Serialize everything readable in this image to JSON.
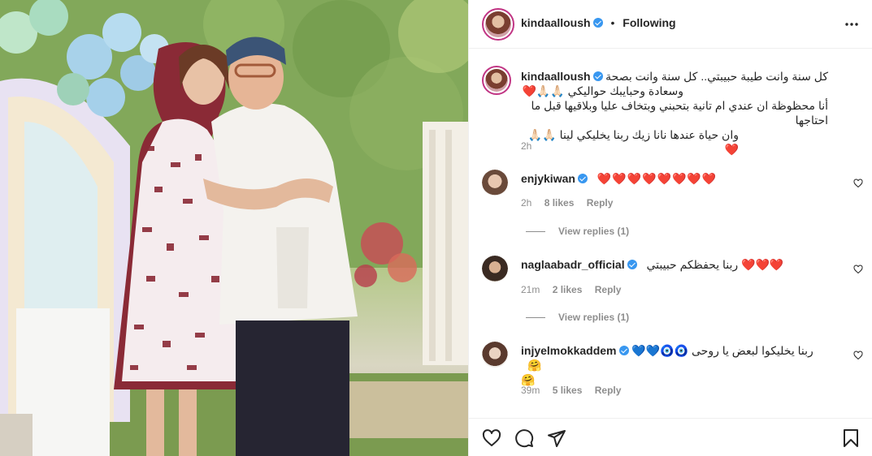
{
  "post": {
    "author": {
      "username": "kindaalloush",
      "verified": true,
      "follow_status": "Following"
    },
    "caption": {
      "line1": "كل سنة وانت طيبة حبيبتي.. كل سنة وانت بصحة",
      "line2": "وسعادة وحبايبك حواليكي 🙏🏻🙏🏻❤️",
      "line3": "أنا محظوظة ان عندي ام تانية بتحبني وبتخاف عليا وبلاقيها قبل ما احتاجها",
      "line4": "وان حياة عندها نانا زيك ربنا يخليكي لينا 🙏🏻🙏🏻❤️",
      "time": "2h"
    },
    "comments": [
      {
        "username": "enjykiwan",
        "verified": true,
        "text": "❤️❤️❤️❤️❤️❤️❤️❤️",
        "time": "2h",
        "likes": "8 likes",
        "reply": "Reply",
        "view_replies": "View replies (1)"
      },
      {
        "username": "naglaabadr_official",
        "verified": true,
        "text": "❤️❤️❤️ ربنا يحفظكم حبيبتي",
        "time": "21m",
        "likes": "2 likes",
        "reply": "Reply",
        "view_replies": "View replies (1)"
      },
      {
        "username": "injyelmokkaddem",
        "verified": true,
        "text": "ربنا يخليكوا لبعض يا روحى 🧿🧿💙💙🤗",
        "text2": "🤗",
        "time": "39m",
        "likes": "5 likes",
        "reply": "Reply"
      }
    ]
  },
  "icons": {
    "more": "more-options-icon",
    "like": "heart-icon",
    "comment": "comment-icon",
    "share": "share-icon",
    "save": "bookmark-icon"
  },
  "colors": {
    "verified": "#3897f0",
    "heart": "#ed4956",
    "muted": "#8e8e8e",
    "text": "#262626",
    "border": "#efefef"
  }
}
